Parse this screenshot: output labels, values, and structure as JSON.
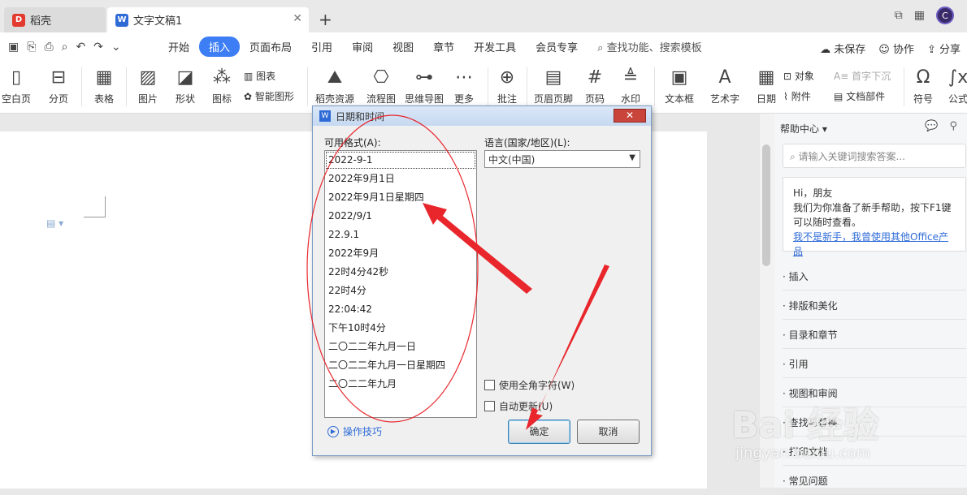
{
  "tabs": [
    {
      "label": "稻壳",
      "icon": "daoke-logo-icon"
    },
    {
      "label": "文字文稿1",
      "icon": "wps-writer-icon"
    }
  ],
  "menu": {
    "items": [
      "开始",
      "插入",
      "页面布局",
      "引用",
      "审阅",
      "视图",
      "章节",
      "开发工具",
      "会员专享"
    ],
    "active": "插入",
    "search": "查找功能、搜索模板",
    "right": [
      "未保存",
      "协作",
      "分享"
    ]
  },
  "ribbon": {
    "big": [
      "空白页",
      "分页",
      "表格",
      "图片",
      "形状",
      "图标",
      "稻壳资源",
      "流程图",
      "思维导图",
      "更多",
      "批注",
      "页眉页脚",
      "页码",
      "水印",
      "文本框",
      "艺术字",
      "日期",
      "符号",
      "公式"
    ],
    "small": [
      "图表",
      "智能图形",
      "对象",
      "首字下沉",
      "附件",
      "文档部件"
    ]
  },
  "dialog": {
    "title": "日期和时间",
    "formats_label": "可用格式(A):",
    "formats": [
      "2022-9-1",
      "2022年9月1日",
      "2022年9月1日星期四",
      "2022/9/1",
      "22.9.1",
      "2022年9月",
      "22时4分42秒",
      "22时4分",
      "22:04:42",
      "下午10时4分",
      "二〇二二年九月一日",
      "二〇二二年九月一日星期四",
      "二〇二二年九月"
    ],
    "lang_label": "语言(国家/地区)(L):",
    "lang_value": "中文(中国)",
    "chk_fullwidth": "使用全角字符(W)",
    "chk_autoupdate": "自动更新(U)",
    "tips": "操作技巧",
    "ok": "确定",
    "cancel": "取消"
  },
  "help": {
    "title": "帮助中心",
    "search_placeholder": "请输入关键词搜索答案...",
    "greeting": "Hi，朋友",
    "message": "我们为你准备了新手帮助，按下F1键可以随时查看。",
    "link": "我不是新手，我曾使用其他Office产品",
    "items": [
      "插入",
      "排版和美化",
      "目录和章节",
      "引用",
      "视图和审阅",
      "查找与替换",
      "打印文档",
      "常见问题"
    ]
  },
  "watermark": {
    "main": "Bai 经验",
    "sub": "jingyan.baidu.com"
  },
  "colors": {
    "accent": "#3d7ef5",
    "annotation": "#e8262c"
  }
}
